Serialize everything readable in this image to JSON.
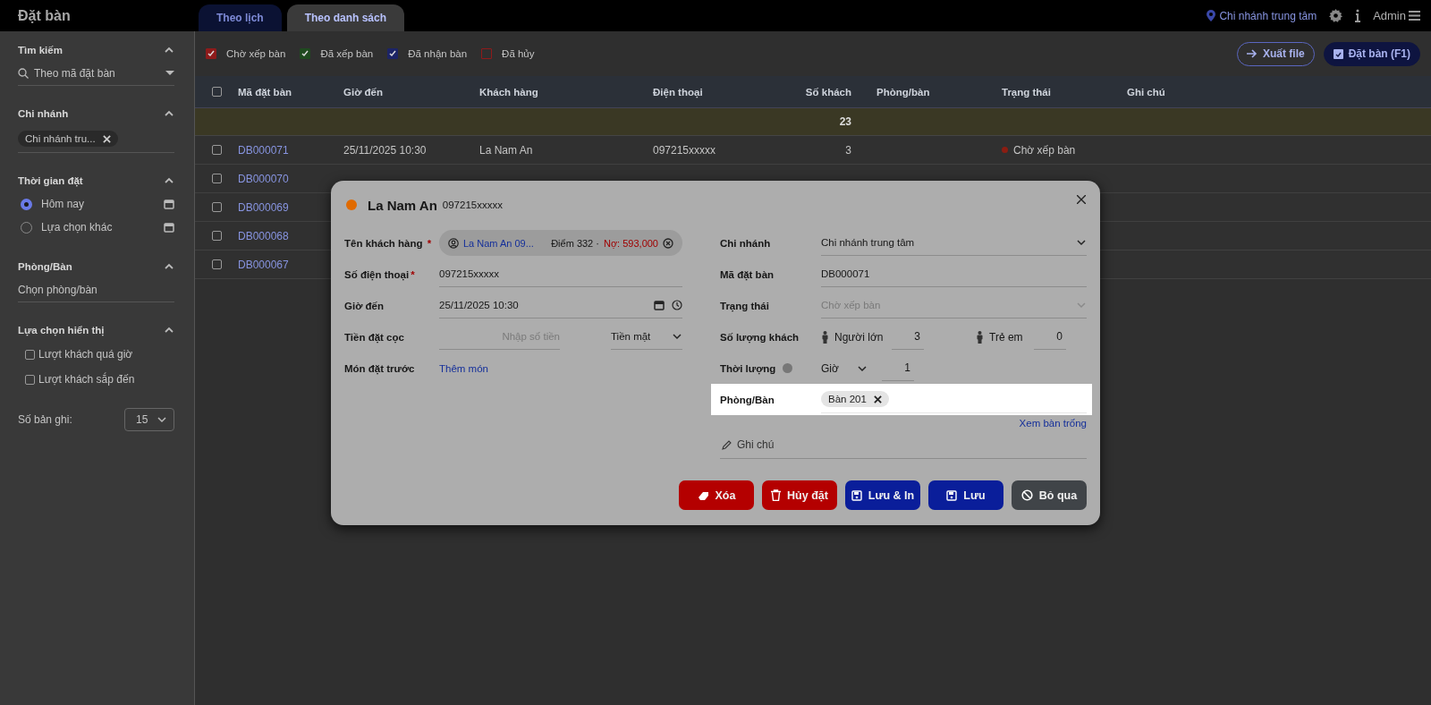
{
  "app": {
    "title": "Đặt bàn"
  },
  "tabs": [
    {
      "label": "Theo lịch",
      "selected": false
    },
    {
      "label": "Theo danh sách",
      "selected": true
    }
  ],
  "header": {
    "branch": "Chi nhánh trung tâm",
    "user": "Admin"
  },
  "sidebar": {
    "search": {
      "title": "Tìm kiếm",
      "placeholder": "Theo mã đặt bàn"
    },
    "branch": {
      "title": "Chi nhánh",
      "chips": [
        "Chi nhánh tru..."
      ]
    },
    "time": {
      "title": "Thời gian đặt",
      "options": [
        {
          "label": "Hôm nay",
          "selected": true
        },
        {
          "label": "Lựa chọn khác",
          "selected": false
        }
      ]
    },
    "room": {
      "title": "Phòng/Bàn",
      "placeholder": "Chọn phòng/bàn"
    },
    "display": {
      "title": "Lựa chọn hiển thị",
      "options": [
        {
          "label": "Lượt khách quá giờ",
          "checked": false
        },
        {
          "label": "Lượt khách sắp đến",
          "checked": false
        }
      ]
    },
    "page_size": {
      "label": "Số bản ghi:",
      "value": "15"
    }
  },
  "filters": [
    {
      "label": "Chờ xếp bàn",
      "checked": true,
      "color": "#8e1b1b"
    },
    {
      "label": "Đã xếp bàn",
      "checked": true,
      "color": "#1f4a1f"
    },
    {
      "label": "Đã nhận bàn",
      "checked": true,
      "color": "#1c2466"
    },
    {
      "label": "Đã hủy",
      "checked": false,
      "color": "#8e1b1b"
    }
  ],
  "actions": [
    {
      "label": "Xuất file",
      "kind": "outline"
    },
    {
      "label": "Đặt bàn (F1)",
      "kind": "filled"
    }
  ],
  "table": {
    "all_checked": false,
    "columns": [
      "Mã đặt bàn",
      "Giờ đến",
      "Khách hàng",
      "Điện thoại",
      "Số khách",
      "Phòng/bàn",
      "Trạng thái",
      "Ghi chú"
    ],
    "summary": {
      "guests": "23"
    },
    "rows": [
      {
        "checked": false,
        "code": "DB000071",
        "time": "25/11/2025 10:30",
        "customer": "La Nam An",
        "phone": "097215xxxxx",
        "guests": "3",
        "status": "Chờ xếp bàn",
        "color": "#8b1d12"
      },
      {
        "checked": false,
        "code": "DB000070"
      },
      {
        "checked": false,
        "code": "DB000069"
      },
      {
        "checked": false,
        "code": "DB000068"
      },
      {
        "checked": false,
        "code": "DB000067"
      }
    ]
  },
  "dialog": {
    "name": "La Nam An",
    "phone": "097215xxxxx",
    "color": "#e06a00",
    "customer": {
      "label": "Tên khách hàng",
      "mark": "*",
      "chip": "La Nam An 09...",
      "points": "Điểm 332 ·",
      "debt": "Nợ: 593,000"
    },
    "phone_field": {
      "label": "Số điện thoại",
      "mark": "*",
      "value": "097215xxxxx"
    },
    "arrival": {
      "label": "Giờ đến",
      "value": "25/11/2025 10:30"
    },
    "deposit": {
      "label": "Tiền đặt cọc",
      "placeholder": "Nhập số tiền",
      "method": "Tiền mặt"
    },
    "preorder": {
      "label": "Món đặt trước",
      "link": "Thêm món"
    },
    "branch": {
      "label": "Chi nhánh",
      "value": "Chi nhánh trung tâm"
    },
    "code": {
      "label": "Mã đặt bàn",
      "value": "DB000071"
    },
    "status": {
      "label": "Trạng thái",
      "value": "Chờ xếp bàn",
      "disabled": true
    },
    "guests": {
      "label": "Số lượng khách",
      "adults_label": "Người lớn",
      "adults": "3",
      "children_label": "Trẻ em",
      "children": "0"
    },
    "duration": {
      "label": "Thời lượng",
      "unit": "Giờ",
      "value": "1"
    },
    "room": {
      "label": "Phòng/Bàn",
      "chips": [
        "Bàn 201"
      ],
      "highlighted": true
    },
    "free_tables_link": "Xem bàn trống",
    "note": {
      "placeholder": "Ghi chú"
    },
    "buttons": [
      {
        "label": "Xóa",
        "kind": "delete"
      },
      {
        "label": "Hủy đặt",
        "kind": "cancel"
      },
      {
        "label": "Lưu & In",
        "kind": "save-print"
      },
      {
        "label": "Lưu",
        "kind": "save"
      },
      {
        "label": "Bỏ qua",
        "kind": "skip"
      }
    ]
  }
}
